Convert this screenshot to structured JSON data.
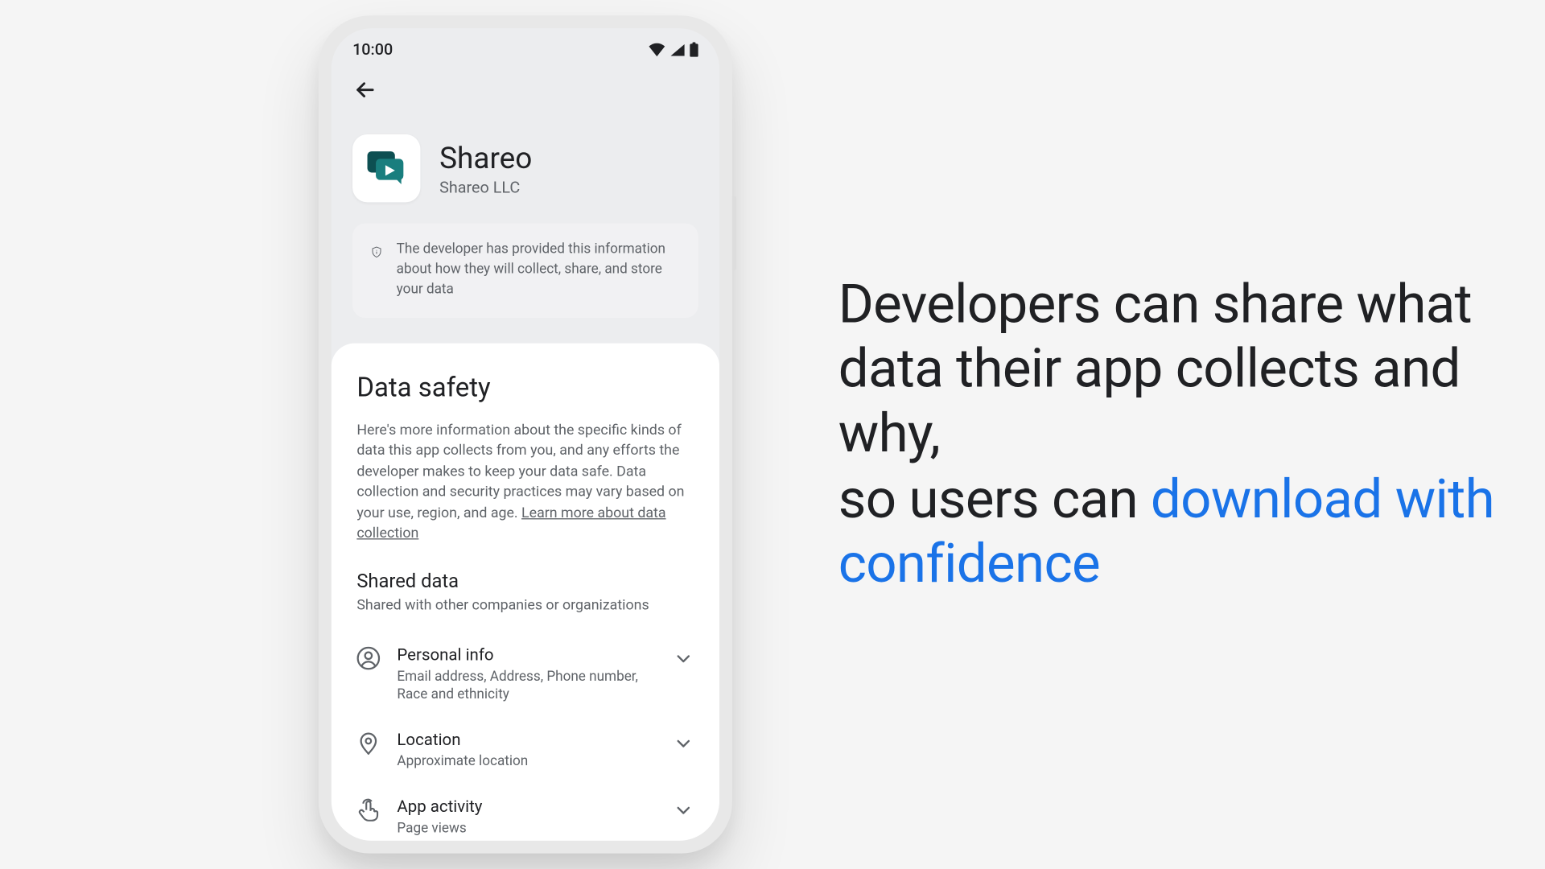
{
  "status": {
    "time": "10:00"
  },
  "app": {
    "name": "Shareo",
    "developer": "Shareo LLC"
  },
  "banner": {
    "text": "The developer has provided this information about how they will collect, share, and store your data"
  },
  "data_safety": {
    "title": "Data safety",
    "description": "Here's more information about the specific kinds of data this app collects from you, and any efforts the developer makes to keep your data safe. Data collection and security practices may vary based on your use, region, and age. ",
    "learn_more": "Learn more about data collection"
  },
  "shared": {
    "title": "Shared data",
    "subtitle": "Shared with other companies or organizations",
    "rows": [
      {
        "title": "Personal info",
        "sub": "Email address, Address, Phone number, Race and ethnicity"
      },
      {
        "title": "Location",
        "sub": "Approximate location"
      },
      {
        "title": "App activity",
        "sub": "Page views"
      }
    ]
  },
  "headline": {
    "part1": "Developers can share what data their app collects and why,",
    "part2": "so users can ",
    "accent": "download with confidence"
  }
}
